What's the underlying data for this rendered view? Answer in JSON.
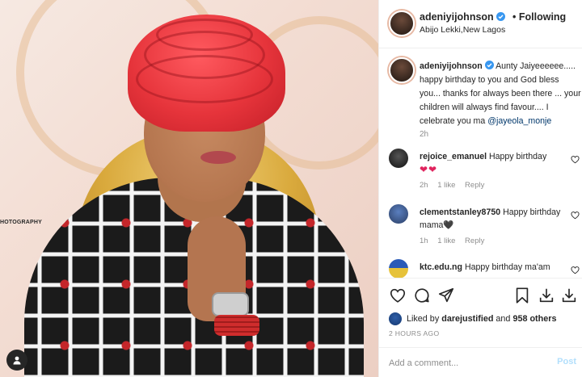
{
  "header": {
    "username": "adeniyijohnson",
    "separator": "•",
    "follow_status": "Following",
    "location": "Abijo Lekki,New Lagos"
  },
  "caption": {
    "username": "adeniyijohnson",
    "text": "Aunty Jaiyeeeeee..... happy birthday to you and God bless you... thanks for always been there ... your children will always find favour.... I celebrate you ma",
    "mention": "@jayeola_monje",
    "time": "2h"
  },
  "comments": [
    {
      "username": "rejoice_emanuel",
      "text": "Happy birthday",
      "emoji": "❤❤",
      "time": "2h",
      "likes": "1 like",
      "reply": "Reply"
    },
    {
      "username": "clementstanley8750",
      "text": "Happy birthday mama🖤",
      "time": "1h",
      "likes": "1 like",
      "reply": "Reply"
    },
    {
      "username": "ktc.edu.ng",
      "text": "Happy birthday ma'am"
    }
  ],
  "photo": {
    "watermark": "HOTOGRAPHY"
  },
  "actions": {
    "liked_prefix": "Liked by",
    "liked_user": "darejustified",
    "liked_and": "and",
    "liked_others": "958 others",
    "post_time": "2 HOURS AGO"
  },
  "composer": {
    "placeholder": "Add a comment...",
    "post_label": "Post"
  },
  "colors": {
    "link": "#00376b",
    "verified": "#3897f0",
    "heart": "#e0245e",
    "post_disabled": "#b2dffc"
  },
  "icons": [
    "verified-icon",
    "heart-icon",
    "comment-icon",
    "share-icon",
    "bookmark-icon",
    "download-icon",
    "user-tag-icon"
  ]
}
